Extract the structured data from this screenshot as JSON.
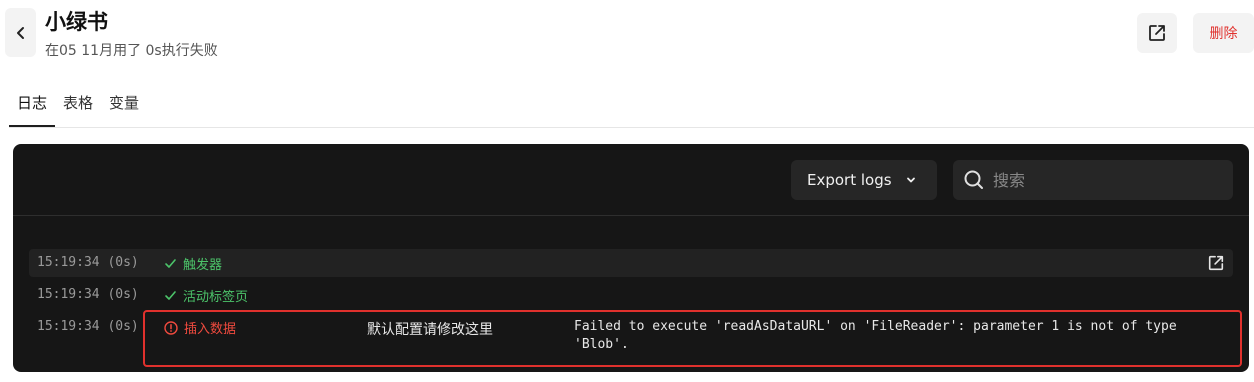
{
  "header": {
    "title": "小绿书",
    "subtitle": "在05 11月用了 0s执行失败",
    "delete_label": "删除"
  },
  "tabs": [
    {
      "label": "日志",
      "active": true
    },
    {
      "label": "表格",
      "active": false
    },
    {
      "label": "变量",
      "active": false
    }
  ],
  "toolbar": {
    "export_label": "Export logs",
    "search_placeholder": "搜索"
  },
  "logs": [
    {
      "time": "15:19:34 (0s)",
      "status": "success",
      "icon": "check-icon",
      "label": "触发器"
    },
    {
      "time": "15:19:34 (0s)",
      "status": "success",
      "icon": "check-icon",
      "label": "活动标签页"
    },
    {
      "time": "15:19:34 (0s)",
      "status": "error",
      "icon": "error-circle-icon",
      "label": "插入数据",
      "config": "默认配置请修改这里",
      "message": "Failed to execute 'readAsDataURL' on 'FileReader': parameter 1 is not of type 'Blob'."
    }
  ],
  "colors": {
    "success": "#4cc46a",
    "error": "#f04a3e",
    "panel_bg": "#161616",
    "delete_text": "#e0312d"
  }
}
